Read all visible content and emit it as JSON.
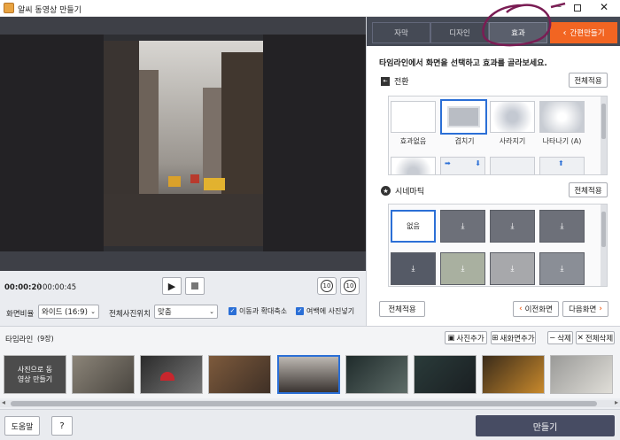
{
  "window": {
    "title": "알씨 동영상 만들기"
  },
  "preview": {
    "time_current": "00:00:20",
    "time_total": "00:00:45"
  },
  "controls": {
    "ratio_label": "화면비율",
    "ratio_value": "와이드 (16:9)",
    "position_label": "전체사진위치",
    "position_value": "맞춤",
    "pan_zoom_label": "이동과 확대축소",
    "margin_label": "여백에 사진넣기",
    "rewind_label": "10",
    "forward_label": "10"
  },
  "tabs": [
    {
      "label": "자막"
    },
    {
      "label": "디자인"
    },
    {
      "label": "효과"
    }
  ],
  "quick_button": "간편만들기",
  "instruction": "타임라인에서 화면을 선택하고 효과를 골라보세요.",
  "transition": {
    "title": "전환",
    "apply_all": "전체적용",
    "items": [
      {
        "label": "효과없음"
      },
      {
        "label": "겹치기"
      },
      {
        "label": "사라지기"
      },
      {
        "label": "나타나기 (A)"
      }
    ]
  },
  "cinematic": {
    "title": "시네마틱",
    "apply_all": "전체적용",
    "items": [
      {
        "label": "없음"
      }
    ]
  },
  "panel_footer": {
    "apply_all": "전체적용",
    "prev": "이전화면",
    "next": "다음화면"
  },
  "timeline": {
    "title": "타임라인",
    "count": "(9장)",
    "add_photo": "사진추가",
    "add_new_screen": "새화면추가",
    "delete": "삭제",
    "delete_all": "전체삭제",
    "first_thumb_text": "사진으로 동영상 만들기"
  },
  "bottom": {
    "help": "도움말",
    "question": "?",
    "make": "만들기"
  },
  "colors": {
    "accent": "#f26522",
    "selection": "#2b6fd6",
    "annotation": "#7a1d54"
  }
}
